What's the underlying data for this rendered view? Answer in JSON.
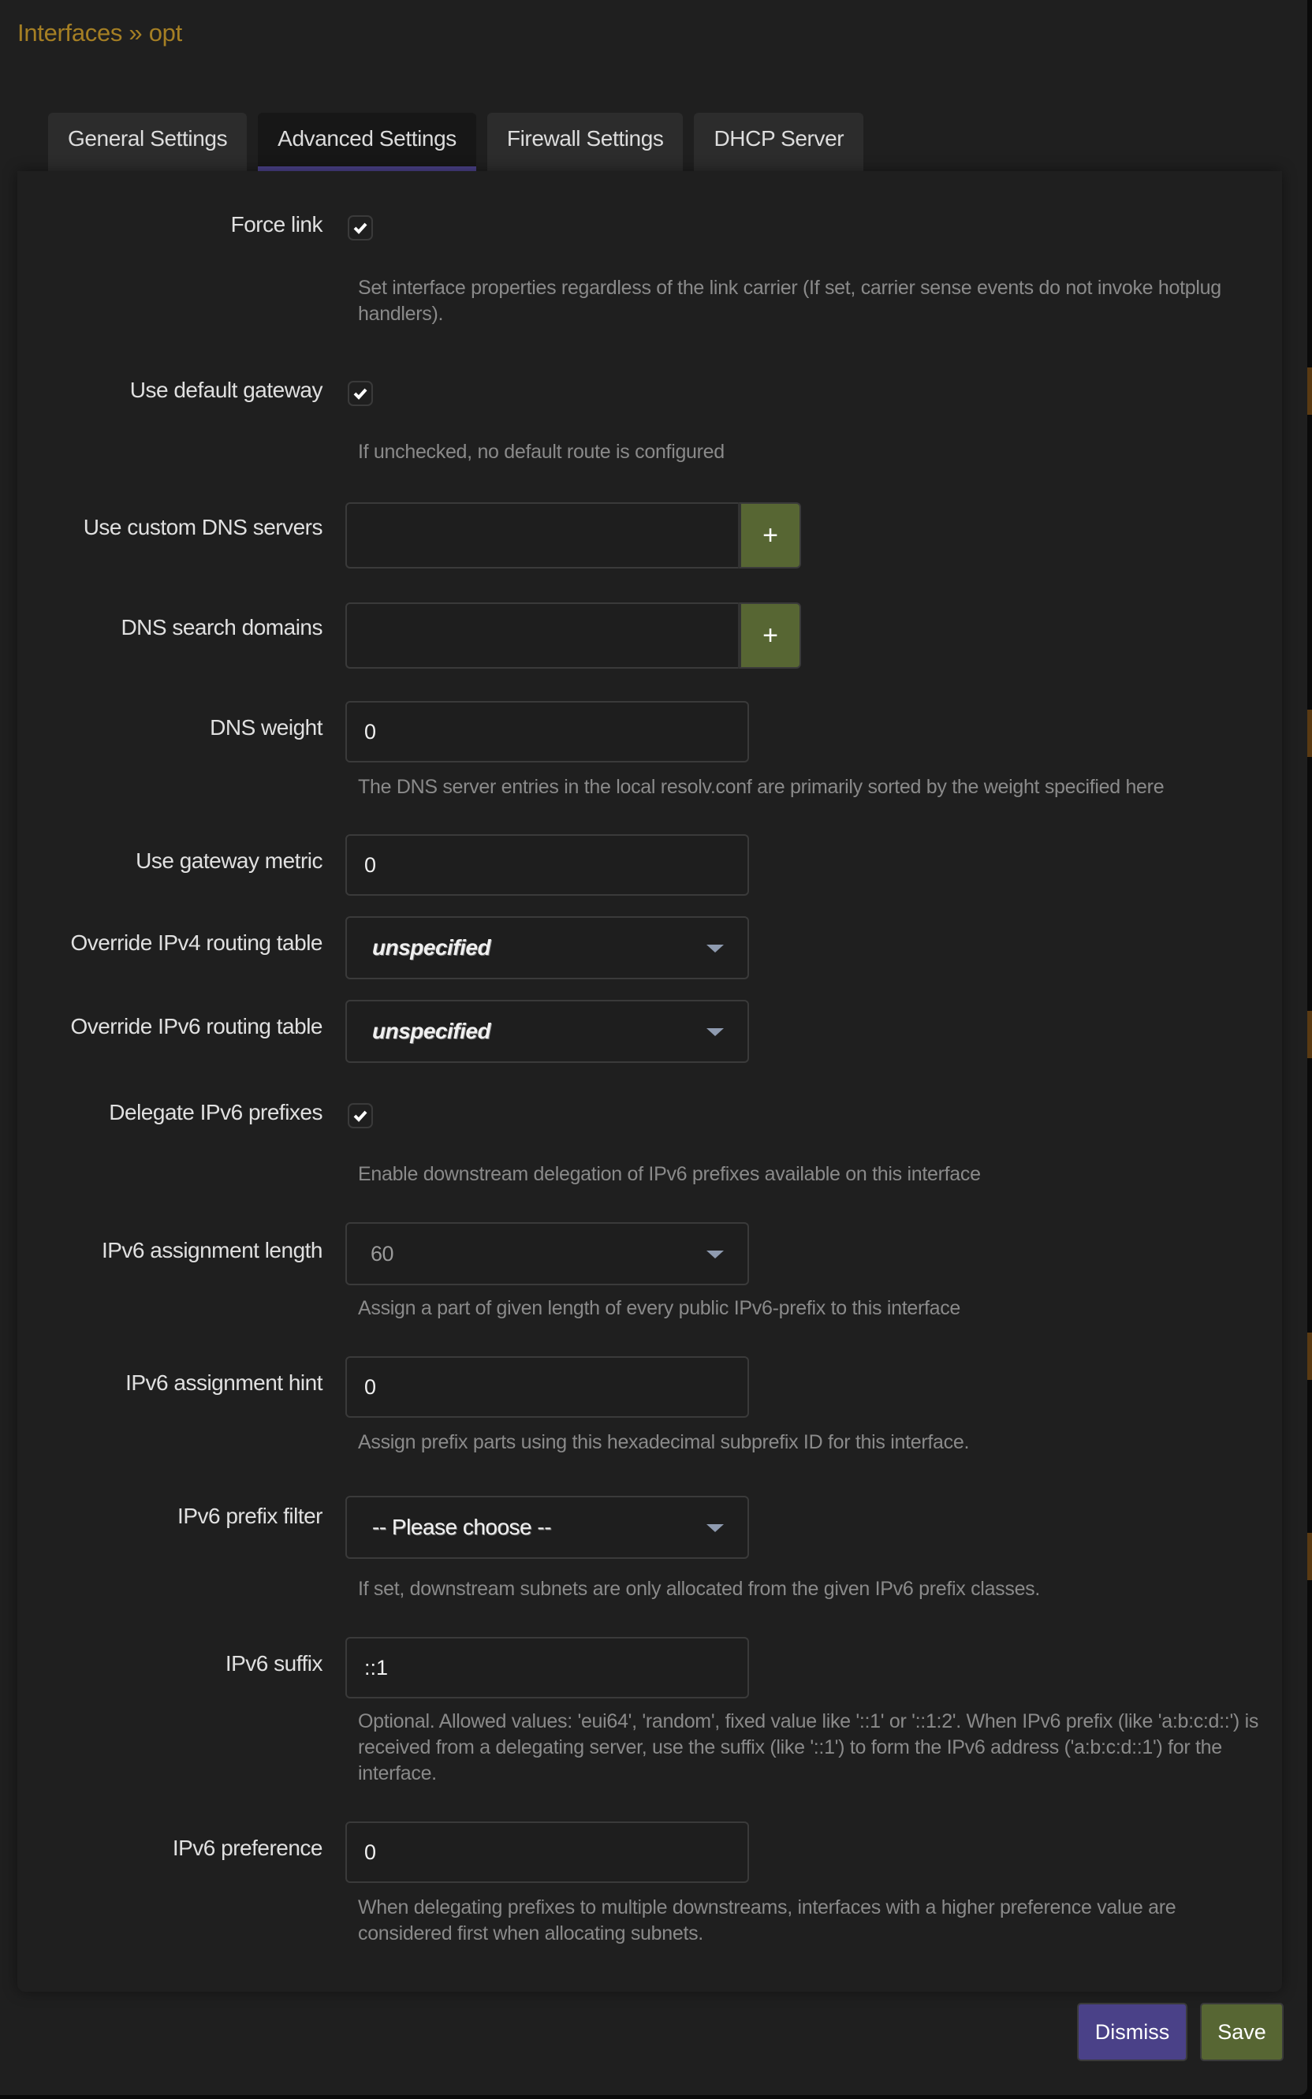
{
  "modal": {
    "title": "Interfaces » opt",
    "tabs": [
      {
        "label": "General Settings",
        "active": false
      },
      {
        "label": "Advanced Settings",
        "active": true
      },
      {
        "label": "Firewall Settings",
        "active": false
      },
      {
        "label": "DHCP Server",
        "active": false
      }
    ]
  },
  "fields": {
    "force_link": {
      "label": "Force link",
      "checked": true,
      "hint": "Set interface properties regardless of the link carrier (If set, carrier sense events do not invoke hotplug handlers)."
    },
    "use_default_gateway": {
      "label": "Use default gateway",
      "checked": true,
      "hint": "If unchecked, no default route is configured"
    },
    "custom_dns": {
      "label": "Use custom DNS servers",
      "value": "",
      "add_icon": "+"
    },
    "dns_search": {
      "label": "DNS search domains",
      "value": "",
      "add_icon": "+"
    },
    "dns_weight": {
      "label": "DNS weight",
      "value": "0",
      "hint": "The DNS server entries in the local resolv.conf are primarily sorted by the weight specified here"
    },
    "gateway_metric": {
      "label": "Use gateway metric",
      "value": "0"
    },
    "ipv4_table": {
      "label": "Override IPv4 routing table",
      "selected": "unspecified"
    },
    "ipv6_table": {
      "label": "Override IPv6 routing table",
      "selected": "unspecified"
    },
    "delegate_ipv6": {
      "label": "Delegate IPv6 prefixes",
      "checked": true,
      "hint": "Enable downstream delegation of IPv6 prefixes available on this interface"
    },
    "ipv6_assign_len": {
      "label": "IPv6 assignment length",
      "selected": "60",
      "hint": "Assign a part of given length of every public IPv6-prefix to this interface"
    },
    "ipv6_assign_hint": {
      "label": "IPv6 assignment hint",
      "value": "0",
      "hint": "Assign prefix parts using this hexadecimal subprefix ID for this interface."
    },
    "ipv6_prefix_filter": {
      "label": "IPv6 prefix filter",
      "selected": "-- Please choose --",
      "hint": "If set, downstream subnets are only allocated from the given IPv6 prefix classes."
    },
    "ipv6_suffix": {
      "label": "IPv6 suffix",
      "value": "::1",
      "hint": "Optional. Allowed values: 'eui64', 'random', fixed value like '::1' or '::1:2'. When IPv6 prefix (like 'a:b:c:d::') is received from a delegating server, use the suffix (like '::1') to form the IPv6 address ('a:b:c:d::1') for the interface."
    },
    "ipv6_preference": {
      "label": "IPv6 preference",
      "value": "0",
      "hint": "When delegating prefixes to multiple downstreams, interfaces with a higher preference value are considered first when allocating subnets."
    }
  },
  "footer": {
    "dismiss_label": "Dismiss",
    "save_label": "Save"
  },
  "colors": {
    "title": "#a57f24",
    "tab_active_underline": "#4a4188",
    "dismiss": "#4a4188",
    "save": "#576633",
    "add_button": "#576633"
  }
}
